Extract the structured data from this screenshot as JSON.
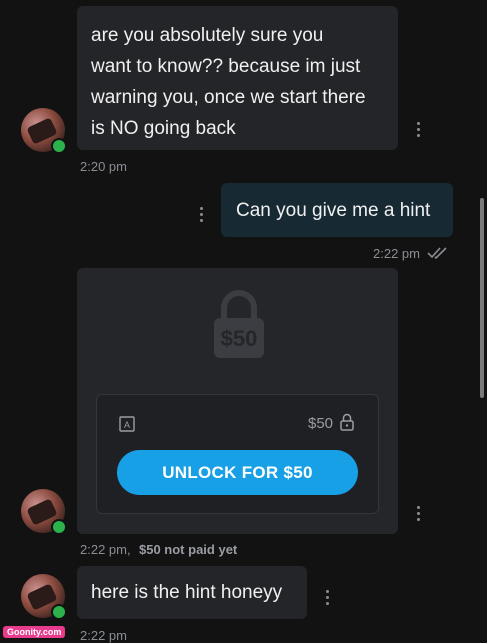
{
  "messages": [
    {
      "text_lines": [
        "are you absolutely sure you",
        "want to know?? because im just",
        "warning you, once we start there",
        "is NO going back"
      ],
      "time": "2:20 pm"
    },
    {
      "text": "Can you give me a hint",
      "time": "2:22 pm"
    },
    {
      "locked_price": "$50",
      "panel_price": "$50",
      "unlock_label": "UNLOCK FOR $50",
      "time": "2:22 pm,",
      "status": "$50 not paid yet"
    },
    {
      "text": "here is the hint honeyy",
      "time": "2:22 pm"
    }
  ],
  "watermark": "Goonity.com",
  "icons": {
    "read_receipt": "double-check-icon",
    "lock": "lock-icon",
    "media": "media-icon",
    "menu": "kebab-menu-icon"
  },
  "colors": {
    "accent": "#18a0e6",
    "online": "#2bb24c",
    "outgoing_bubble": "#172a34"
  }
}
